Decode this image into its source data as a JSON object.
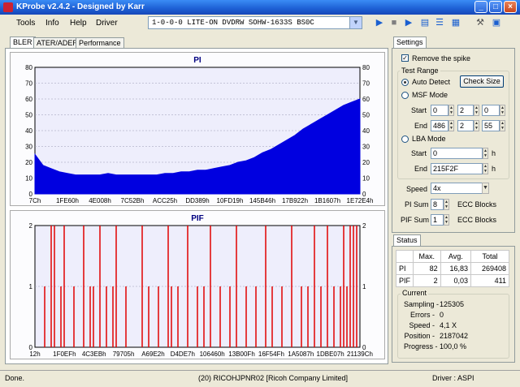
{
  "window": {
    "title": "KProbe v2.4.2 - Designed by Karr"
  },
  "menu": [
    "Tools",
    "Info",
    "Help",
    "Driver"
  ],
  "device": {
    "selected": "1-0-0-0 LITE-ON DVDRW SOHW-1633S BS0C"
  },
  "tabs": [
    "BLER",
    "ATER/ADER",
    "Performance"
  ],
  "settings": {
    "tab": "Settings",
    "remove_spike_label": "Remove the spike",
    "test_range_label": "Test Range",
    "auto_detect_label": "Auto Detect",
    "check_size_label": "Check Size",
    "msf_mode_label": "MSF Mode",
    "start_label": "Start",
    "end_label": "End",
    "msf_start": [
      "0",
      "2",
      "0"
    ],
    "msf_end": [
      "486",
      "2",
      "55"
    ],
    "lba_mode_label": "LBA Mode",
    "lba_start": "0",
    "lba_end": "215F2F",
    "h_unit": "h",
    "speed_label": "Speed",
    "speed_value": "4x",
    "pi_sum_label": "PI Sum",
    "pi_sum_value": "8",
    "pif_sum_label": "PIF Sum",
    "pif_sum_value": "1",
    "ecc_label": "ECC Blocks"
  },
  "status": {
    "tab": "Status",
    "headers": [
      "",
      "Max.",
      "Avg.",
      "Total"
    ],
    "rows": [
      [
        "PI",
        "82",
        "16,83",
        "269408"
      ],
      [
        "PIF",
        "2",
        "0,03",
        "411"
      ]
    ],
    "current_label": "Current",
    "current": [
      {
        "label": "Sampling -",
        "value": "125305"
      },
      {
        "label": "Errors -",
        "value": "0"
      },
      {
        "label": "Speed -",
        "value": "4,1  X"
      },
      {
        "label": "Position -",
        "value": "2187042"
      },
      {
        "label": "Progress -",
        "value": "100,0 %"
      }
    ]
  },
  "statusbar": {
    "left": "Done.",
    "center": "(20) RICOHJPNR02 [Ricoh Company Limited]",
    "right": "Driver : ASPI"
  },
  "chart_data": [
    {
      "type": "area",
      "title": "PI",
      "ylim": [
        0,
        80
      ],
      "yticks": [
        0,
        10,
        20,
        30,
        40,
        50,
        60,
        70,
        80
      ],
      "xticks": [
        "7Ch",
        "1FE60h",
        "4E008h",
        "7C52Bh",
        "ACC25h",
        "DD389h",
        "10FD19h",
        "145B46h",
        "17B922h",
        "1B1607h",
        "1E72E4h"
      ],
      "series": [
        {
          "values": [
            25,
            18,
            16,
            14,
            13,
            12,
            12,
            12,
            12,
            13,
            12,
            12,
            12,
            12,
            12,
            12,
            13,
            13,
            14,
            14,
            15,
            15,
            16,
            17,
            18,
            20,
            21,
            23,
            26,
            28,
            31,
            34,
            37,
            41,
            44,
            47,
            50,
            53,
            56,
            58,
            60
          ]
        }
      ],
      "colors": {
        "fill": "#0000e0",
        "plot_bg": "#eeeefc"
      }
    },
    {
      "type": "bar",
      "title": "PIF",
      "ylim": [
        0,
        2
      ],
      "yticks": [
        0,
        1,
        2
      ],
      "xticks": [
        "12h",
        "1F0EFh",
        "4C3EBh",
        "79705h",
        "A69E2h",
        "D4DE7h",
        "106460h",
        "13B00Fh",
        "16F54Fh",
        "1A5087h",
        "1DBE07h",
        "21139Ch"
      ],
      "x": [
        0.03,
        0.05,
        0.06,
        0.08,
        0.09,
        0.12,
        0.15,
        0.17,
        0.18,
        0.2,
        0.22,
        0.24,
        0.25,
        0.28,
        0.33,
        0.35,
        0.38,
        0.41,
        0.42,
        0.44,
        0.47,
        0.5,
        0.52,
        0.54,
        0.57,
        0.6,
        0.62,
        0.65,
        0.68,
        0.71,
        0.73,
        0.76,
        0.79,
        0.82,
        0.84,
        0.86,
        0.88,
        0.9,
        0.92,
        0.94,
        0.95,
        0.96,
        0.97,
        0.98,
        0.99
      ],
      "values": [
        1,
        2,
        2,
        1,
        2,
        1,
        2,
        1,
        1,
        2,
        1,
        1,
        2,
        1,
        2,
        1,
        1,
        2,
        1,
        1,
        2,
        1,
        1,
        2,
        1,
        1,
        2,
        1,
        1,
        2,
        1,
        1,
        2,
        1,
        1,
        2,
        1,
        2,
        1,
        1,
        2,
        1,
        2,
        2,
        2
      ],
      "colors": {
        "bar": "#e00000",
        "plot_bg": "#eeeefc"
      }
    }
  ]
}
